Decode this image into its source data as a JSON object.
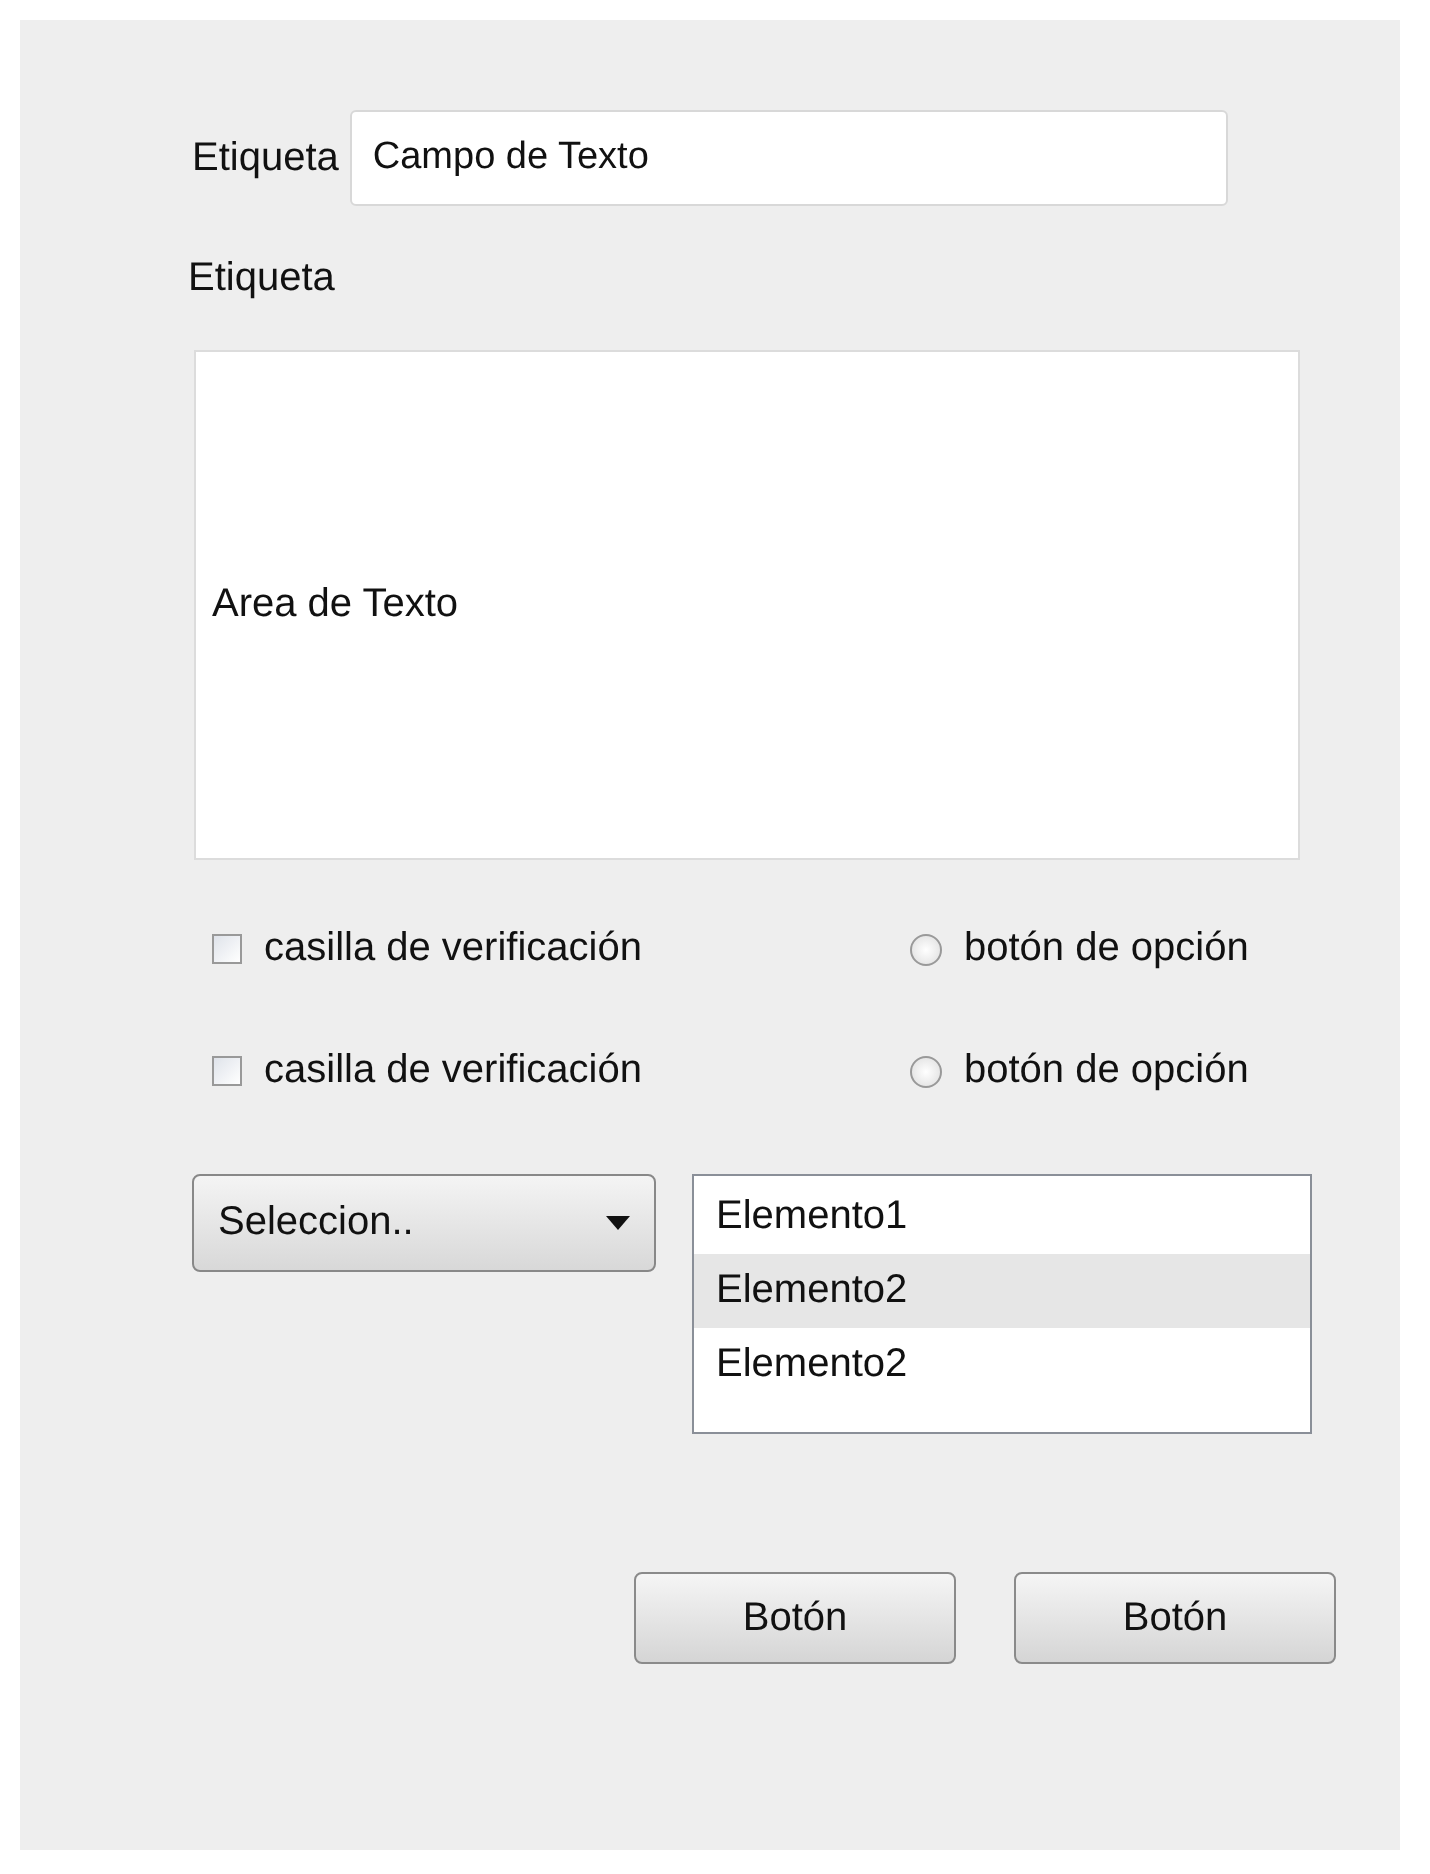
{
  "form": {
    "field_label": "Etiqueta",
    "field_value": "Campo de Texto",
    "area_label": "Etiqueta",
    "area_value": "Area de Texto"
  },
  "option_rows": [
    {
      "checkbox": {
        "label": "casilla de verificación",
        "checked": false
      },
      "radio": {
        "label": "botón de opción",
        "selected": false
      }
    },
    {
      "checkbox": {
        "label": "casilla de verificación",
        "checked": false
      },
      "radio": {
        "label": "botón de opción",
        "selected": false
      }
    }
  ],
  "dropdown": {
    "value": "Seleccion.."
  },
  "list": [
    {
      "label": "Elemento1",
      "selected": false
    },
    {
      "label": "Elemento2",
      "selected": true
    },
    {
      "label": "Elemento2",
      "selected": false
    }
  ],
  "buttons": [
    "Botón",
    "Botón"
  ]
}
